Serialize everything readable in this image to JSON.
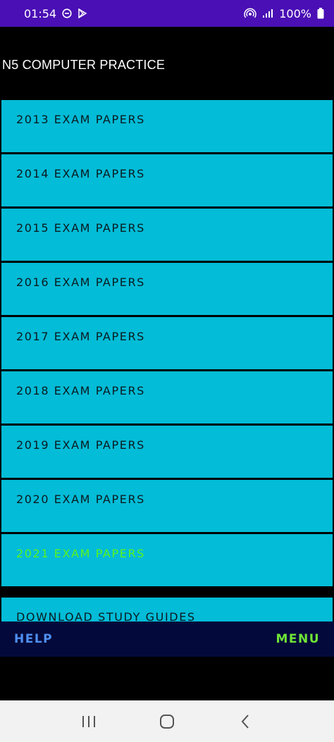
{
  "status_bar": {
    "time": "01:54",
    "battery": "100%",
    "icons": [
      "do-not-disturb-icon",
      "play-store-icon",
      "hotspot-icon",
      "signal-icon"
    ]
  },
  "app_bar": {
    "title": "N5 COMPUTER PRACTICE"
  },
  "list": {
    "items": [
      {
        "label": "2013 EXAM PAPERS"
      },
      {
        "label": "2014 EXAM PAPERS"
      },
      {
        "label": "2015 EXAM PAPERS"
      },
      {
        "label": "2016 EXAM PAPERS"
      },
      {
        "label": "2017 EXAM PAPERS"
      },
      {
        "label": "2018 EXAM PAPERS"
      },
      {
        "label": "2019 EXAM PAPERS"
      },
      {
        "label": "2020 EXAM PAPERS"
      },
      {
        "label": "2021 EXAM PAPERS"
      },
      {
        "label": "DOWNLOAD STUDY GUIDES"
      }
    ]
  },
  "bottom_bar": {
    "help_label": "HELP",
    "menu_label": "MENU"
  },
  "nav_bar": {
    "icons": [
      "recent-apps-icon",
      "home-icon",
      "back-icon"
    ]
  },
  "colors": {
    "status_bar": "#4a0fb5",
    "list_item": "#03bcd7",
    "highlight_text": "#5af51c",
    "bottom_bar": "#030a3b",
    "help": "#4f8ff2",
    "menu": "#6fe536"
  }
}
